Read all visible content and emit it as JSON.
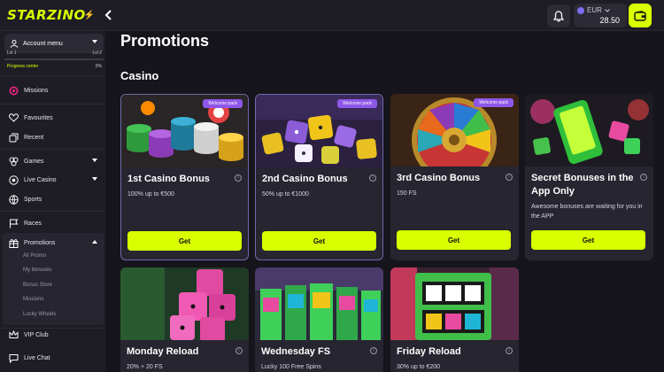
{
  "brand": {
    "logo_text": "STARZINO"
  },
  "header": {
    "balance_currency": "EUR",
    "balance_amount": "28.50"
  },
  "sidebar": {
    "account_menu": "Account menu",
    "level_left": "Lvl 1",
    "level_right": "Lvl 2",
    "progress_label": "Progress center",
    "progress_value": "0%",
    "progress_fraction": 0,
    "items": [
      {
        "label": "Missions"
      },
      {
        "label": "Favourites"
      },
      {
        "label": "Recent"
      },
      {
        "label": "Games"
      },
      {
        "label": "Live Casino"
      },
      {
        "label": "Sports"
      },
      {
        "label": "Races"
      },
      {
        "label": "Promotions"
      },
      {
        "label": "VIP Club"
      },
      {
        "label": "Live Chat"
      }
    ],
    "promo_sub": [
      "All Promo",
      "My bonuses",
      "Bonus Store",
      "Missions",
      "Lucky Wheels"
    ]
  },
  "main": {
    "title": "Promotions",
    "section": "Casino",
    "cards": [
      {
        "badge": "Welcome pack",
        "title": "1st Casino Bonus",
        "desc": "100% up to €500",
        "button": "Get"
      },
      {
        "badge": "Welcome pack",
        "title": "2nd Casino Bonus",
        "desc": "50% up to €1000",
        "button": "Get"
      },
      {
        "badge": "Welcome pack",
        "title": "3rd Casino Bonus",
        "desc": "150 FS",
        "button": "Get"
      },
      {
        "badge": "",
        "title": "Secret Bonuses in the App Only",
        "desc": "Awesome bonuses are waiting for you in the APP",
        "button": "Get"
      },
      {
        "badge": "",
        "title": "Monday Reload",
        "desc": "20% + 20 FS",
        "button": ""
      },
      {
        "badge": "",
        "title": "Wednesday FS",
        "desc": "Lucky 100 Free Spins",
        "button": ""
      },
      {
        "badge": "",
        "title": "Friday Reload",
        "desc": "30% up to €200",
        "button": ""
      }
    ]
  },
  "colors": {
    "accent": "#d8ff00",
    "badge": "#8e57e8",
    "bg": "#16151c",
    "panel": "#1e1d25"
  }
}
